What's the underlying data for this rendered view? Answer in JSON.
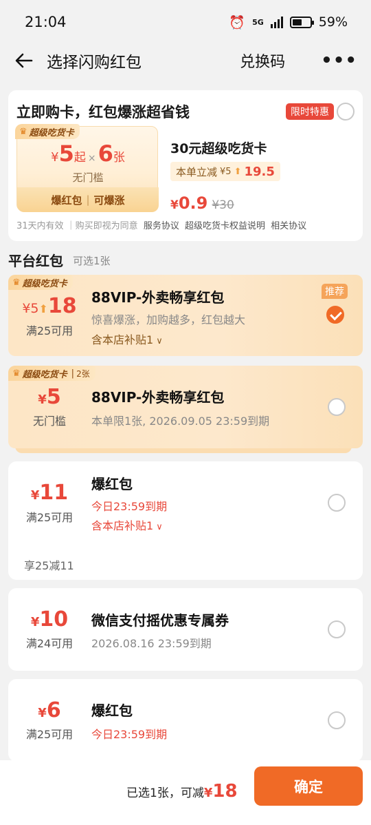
{
  "status": {
    "time": "21:04",
    "network": "5G",
    "battery": "59%"
  },
  "nav": {
    "title": "选择闪购红包",
    "redeem": "兑换码",
    "more": "•••"
  },
  "promo": {
    "headline": "立即购卡，红包爆涨超省钱",
    "badge": "限时特惠",
    "tag": "超级吃货卡",
    "amount_cur": "¥",
    "amount_start": "5",
    "amount_start_suffix": "起",
    "times": "×",
    "count": "6",
    "count_unit": "张",
    "no_threshold": "无门槛",
    "foot_left": "爆红包",
    "foot_sep": "|",
    "foot_right": "可爆涨",
    "card_name": "30元超级吃货卡",
    "reduce_label": "本单立减",
    "reduce_from": "¥5",
    "reduce_to": "19.5",
    "price_cur": "¥",
    "price": "0.9",
    "old_price": "¥30",
    "agree_prefix": "31天内有效 ｜购买即视为同意",
    "agree_link1": "服务协议",
    "agree_link2": "超级吃货卡权益说明",
    "agree_link3": "相关协议",
    "selected": false
  },
  "section": {
    "title": "平台红包",
    "sub": "可选1张"
  },
  "coupons": [
    {
      "tag": "超级吃货卡",
      "amount_from": "¥5",
      "amount": "18",
      "condition": "满25可用",
      "title": "88VIP-外卖畅享红包",
      "desc": "惊喜爆涨，加购越多，红包越大",
      "extra": "含本店补贴1",
      "recommend": "推荐",
      "selected": true
    },
    {
      "tag": "超级吃货卡",
      "tag_count": "2张",
      "cur": "¥",
      "amount": "5",
      "condition": "无门槛",
      "title": "88VIP-外卖畅享红包",
      "desc": "本单限1张, 2026.09.05 23:59到期",
      "selected": false
    },
    {
      "cur": "¥",
      "amount": "11",
      "condition": "满25可用",
      "title": "爆红包",
      "expire": "今日23:59到期",
      "extra": "含本店补贴1",
      "note": "享25减11",
      "selected": false
    },
    {
      "cur": "¥",
      "amount": "10",
      "condition": "满24可用",
      "title": "微信支付摇优惠专属券",
      "desc": "2026.08.16 23:59到期",
      "selected": false
    },
    {
      "cur": "¥",
      "amount": "6",
      "condition": "满25可用",
      "title": "爆红包",
      "expire": "今日23:59到期",
      "selected": false
    }
  ],
  "bottom": {
    "selected_text": "已选1张，可减",
    "cur": "¥",
    "amount": "18",
    "confirm": "确定"
  },
  "colors": {
    "accent": "#f06a26",
    "price_red": "#e8483a",
    "vip_bg": "#fde6c6"
  }
}
